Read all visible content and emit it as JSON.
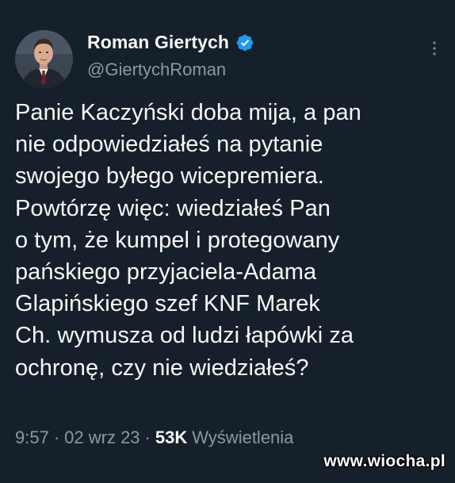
{
  "theme": {
    "background": "#15202b",
    "text_primary": "#f7f9f9",
    "text_secondary": "#8b98a5",
    "verified_badge": "#1d9bf0"
  },
  "tweet": {
    "author": {
      "display_name": "Roman Giertych",
      "handle": "@GiertychRoman",
      "verified": true,
      "verified_icon": "verified-badge-icon",
      "avatar_icon": "avatar"
    },
    "more_icon": "more-options-icon",
    "text": "Panie Kaczyński doba mija, a pan\nnie odpowiedziałeś na pytanie\nswojego byłego wicepremiera.\nPowtórzę więc: wiedziałeś Pan\no tym, że kumpel i protegowany\npańskiego przyjaciela-Adama\nGlapińskiego szef KNF Marek\nCh. wymusza od ludzi łapówki za\nochronę, czy nie wiedziałeś?",
    "meta": {
      "time": "9:57",
      "separator": "·",
      "date": "02 wrz 23",
      "views_count": "53K",
      "views_label": "Wyświetlenia"
    }
  },
  "watermark": {
    "text": "www.wiocha.pl"
  }
}
